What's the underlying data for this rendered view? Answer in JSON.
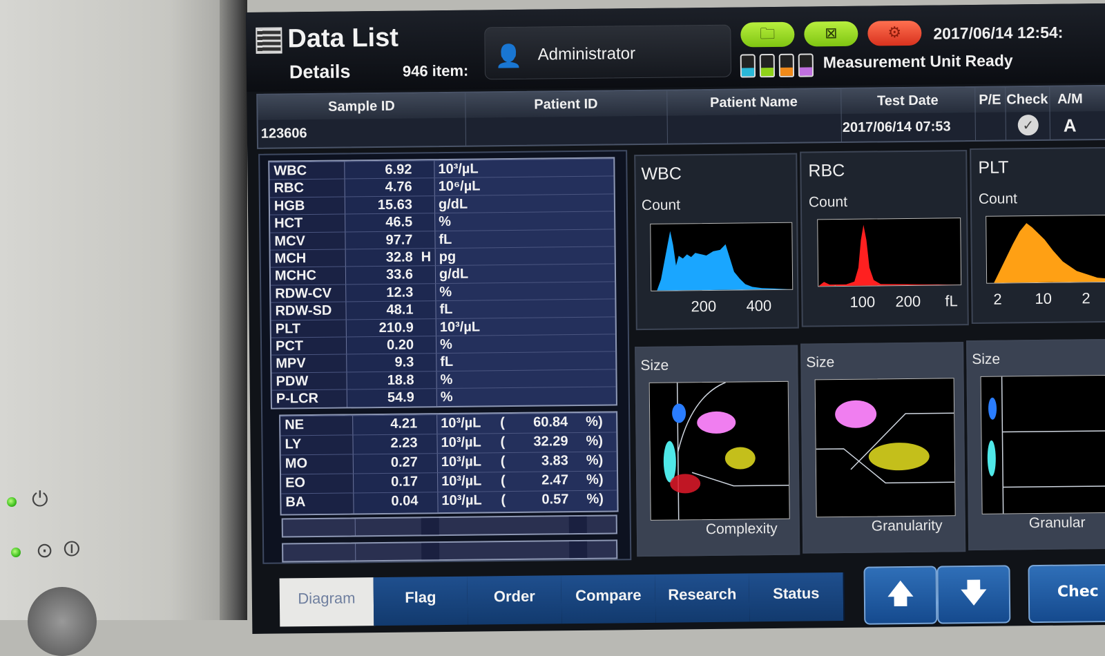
{
  "header": {
    "title": "Data List",
    "subtitle": "Details",
    "item_count": "946 item:",
    "user": "Administrator",
    "datetime": "2017/06/14 12:54:",
    "status": "Measurement Unit Ready",
    "icons": [
      "folder-icon",
      "chart-icon",
      "gear-icon"
    ],
    "colors": {
      "green_button": "#8fd21a",
      "red_button": "#e0402a"
    }
  },
  "sample_table": {
    "headers": [
      "Sample ID",
      "Patient ID",
      "Patient Name",
      "Test Date",
      "P/E",
      "Check",
      "A/M"
    ],
    "sample_id": "123606",
    "patient_id": "",
    "patient_name": "",
    "test_date": "2017/06/14 07:53",
    "pe": "",
    "check": "✓",
    "am": "A"
  },
  "results": [
    {
      "name": "WBC",
      "value": "6.92",
      "flag": "",
      "unit": "10³/µL"
    },
    {
      "name": "RBC",
      "value": "4.76",
      "flag": "",
      "unit": "10⁶/µL"
    },
    {
      "name": "HGB",
      "value": "15.63",
      "flag": "",
      "unit": "g/dL"
    },
    {
      "name": "HCT",
      "value": "46.5",
      "flag": "",
      "unit": "%"
    },
    {
      "name": "MCV",
      "value": "97.7",
      "flag": "",
      "unit": "fL"
    },
    {
      "name": "MCH",
      "value": "32.8",
      "flag": "H",
      "unit": "pg"
    },
    {
      "name": "MCHC",
      "value": "33.6",
      "flag": "",
      "unit": "g/dL"
    },
    {
      "name": "RDW-CV",
      "value": "12.3",
      "flag": "",
      "unit": "%"
    },
    {
      "name": "RDW-SD",
      "value": "48.1",
      "flag": "",
      "unit": "fL"
    },
    {
      "name": "PLT",
      "value": "210.9",
      "flag": "",
      "unit": "10³/µL"
    },
    {
      "name": "PCT",
      "value": "0.20",
      "flag": "",
      "unit": "%"
    },
    {
      "name": "MPV",
      "value": "9.3",
      "flag": "",
      "unit": "fL"
    },
    {
      "name": "PDW",
      "value": "18.8",
      "flag": "",
      "unit": "%"
    },
    {
      "name": "P-LCR",
      "value": "54.9",
      "flag": "",
      "unit": "%"
    }
  ],
  "differential": [
    {
      "name": "NE",
      "value": "4.21",
      "unit": "10³/µL",
      "open": "(",
      "pct": "60.84",
      "close": "%)"
    },
    {
      "name": "LY",
      "value": "2.23",
      "unit": "10³/µL",
      "open": "(",
      "pct": "32.29",
      "close": "%)"
    },
    {
      "name": "MO",
      "value": "0.27",
      "unit": "10³/µL",
      "open": "(",
      "pct": "3.83",
      "close": "%)"
    },
    {
      "name": "EO",
      "value": "0.17",
      "unit": "10³/µL",
      "open": "(",
      "pct": "2.47",
      "close": "%)"
    },
    {
      "name": "BA",
      "value": "0.04",
      "unit": "10³/µL",
      "open": "(",
      "pct": "0.57",
      "close": "%)"
    }
  ],
  "histograms": [
    {
      "title": "WBC",
      "ylabel": "Count",
      "ticks": [
        "200",
        "400"
      ],
      "unit": "",
      "color": "#1aa6ff"
    },
    {
      "title": "RBC",
      "ylabel": "Count",
      "ticks": [
        "100",
        "200"
      ],
      "unit": "fL",
      "color": "#ff2020"
    },
    {
      "title": "PLT",
      "ylabel": "Count",
      "ticks": [
        "2",
        "10",
        "2"
      ],
      "unit": "",
      "color": "#ffa014"
    }
  ],
  "scattergrams": [
    {
      "ylabel": "Size",
      "xlabel": "Complexity"
    },
    {
      "ylabel": "Size",
      "xlabel": "Granularity"
    },
    {
      "ylabel": "Size",
      "xlabel": "Granular"
    }
  ],
  "tabs": [
    "Diagram",
    "Flag",
    "Order",
    "Compare",
    "Research",
    "Status"
  ],
  "nav": {
    "up": "🡅",
    "down": "🡇",
    "check": "Chec"
  }
}
